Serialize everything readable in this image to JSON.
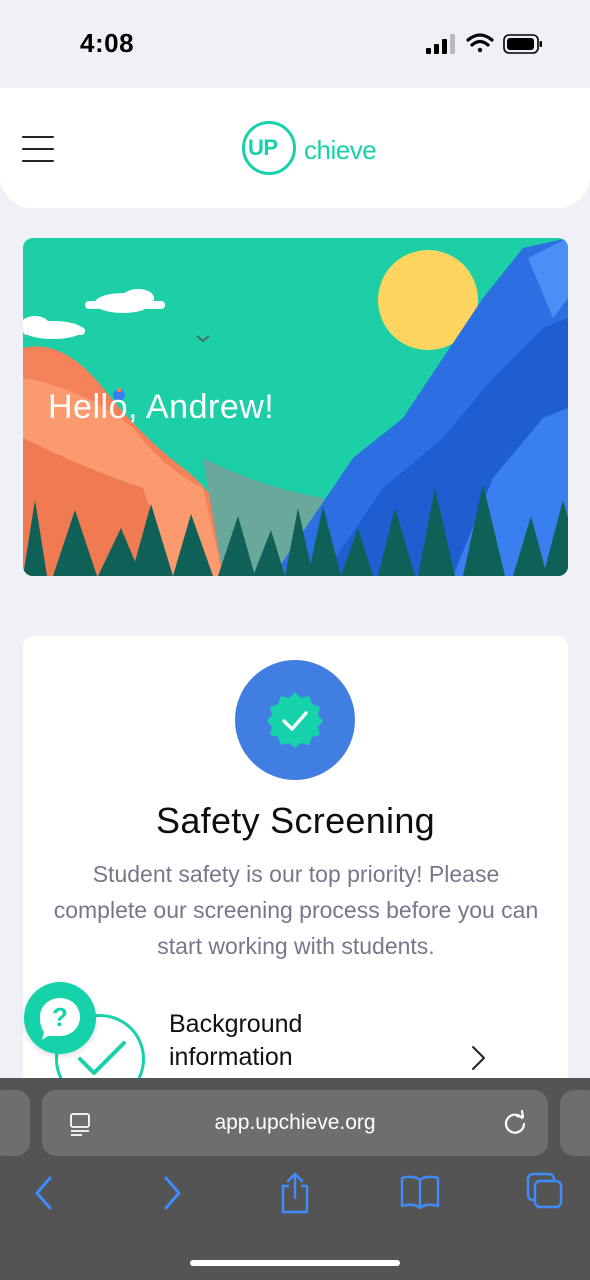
{
  "status_bar": {
    "time": "4:08"
  },
  "header": {
    "logo_up": "UP",
    "logo_rest": "chieve"
  },
  "hero": {
    "greeting": "Hello, Andrew!"
  },
  "screening_card": {
    "title": "Safety Screening",
    "description": "Student safety is our top priority! Please complete our screening process before you can start working with students.",
    "steps": [
      {
        "label": "Background information",
        "completed": true
      }
    ]
  },
  "browser": {
    "url": "app.upchieve.org"
  },
  "icons": {
    "menu": "hamburger-menu-icon",
    "badge": "verified-badge-icon",
    "help": "help-chat-icon",
    "step_status": "checkmark-icon",
    "chevron": "chevron-right-icon",
    "reader": "reader-mode-icon",
    "reload": "reload-icon",
    "back": "back-arrow-icon",
    "forward": "forward-arrow-icon",
    "share": "share-icon",
    "bookmarks": "bookmarks-icon",
    "tabs": "tabs-icon"
  },
  "colors": {
    "brand_green": "#16d2aa",
    "badge_blue": "#417ee1",
    "background": "#eff1f6",
    "browser_bar": "#545454",
    "browser_accent": "#3f8cff"
  }
}
